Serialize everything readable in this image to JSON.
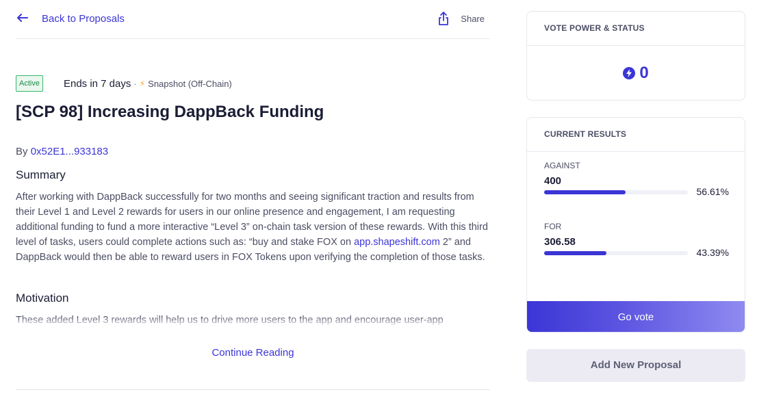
{
  "nav": {
    "back_label": "Back to Proposals",
    "share_label": "Share",
    "back_icon": "arrow-left-icon",
    "share_icon": "share-upload-icon"
  },
  "proposal": {
    "status": "Active",
    "ends": "Ends in 7 days",
    "separator": "·",
    "source": "Snapshot (Off-Chain)",
    "title": "[SCP 98] Increasing DappBack Funding",
    "by_prefix": "By",
    "author": "0x52E1...933183",
    "summary_heading": "Summary",
    "summary_text_1": "After working with DappBack successfully for two months and seeing significant traction and results from their Level 1 and Level 2 rewards for users in our online presence and engagement, I am requesting additional funding to fund a more interactive “Level 3” on-chain task version of these rewards. With this third level of tasks, users could complete actions such as: “buy and stake FOX on ",
    "summary_link": "app.shapeshift.com",
    "summary_link_suffix": " 2",
    "summary_text_2": "” and DappBack would then be able to reward users in FOX Tokens upon verifying the completion of those tasks.",
    "motivation_heading": "Motivation",
    "motivation_text": "These added Level 3 rewards will help us to drive more users to the app and encourage user-app",
    "continue_label": "Continue Reading"
  },
  "vote_power": {
    "heading": "VOTE POWER & STATUS",
    "value": "0",
    "icon": "lightning-circle-icon"
  },
  "results": {
    "heading": "CURRENT RESULTS",
    "items": [
      {
        "label": "AGAINST",
        "value": "400",
        "percent_text": "56.61%",
        "percent": 56.61
      },
      {
        "label": "FOR",
        "value": "306.58",
        "percent_text": "43.39%",
        "percent": 43.39
      }
    ],
    "go_vote_label": "Go vote"
  },
  "actions": {
    "add_proposal_label": "Add New Proposal"
  },
  "colors": {
    "accent": "#3b35d6",
    "active_green": "#1c8a48"
  }
}
